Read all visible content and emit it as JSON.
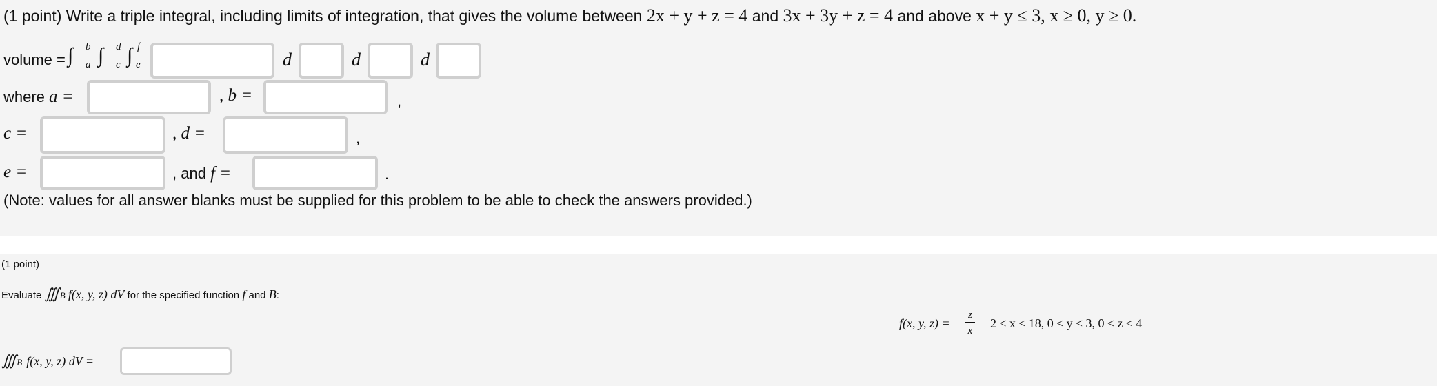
{
  "problem1": {
    "prefix": "(1 point) Write a triple integral, including limits of integration, that gives the volume between",
    "plane1": "2x + y + z = 4",
    "and1": "and",
    "plane2": "3x + 3y + z = 4",
    "and_above": "and above",
    "region": "x + y ≤ 3, x ≥ 0, y ≥ 0.",
    "volume_label": "volume =",
    "integral": "∫",
    "upper1": "b",
    "lower1": "a",
    "upper2": "d",
    "lower2": "c",
    "upper3": "f",
    "lower3": "e",
    "d_label": "d",
    "where": "where",
    "a_eq": "a =",
    "b_eq": ", b =",
    "c_eq": "c =",
    "d_eq": ", d =",
    "e_eq": "e =",
    "and_f": ", and",
    "f_eq": "f =",
    "comma": ",",
    "period": ".",
    "note": "(Note: values for all answer blanks must be supplied for this problem to be able to check the answers provided.)"
  },
  "problem2": {
    "points": "(1 point)",
    "evaluate": "Evaluate",
    "triple_int": "∭",
    "sub_B": "B",
    "integrand": "f(x, y, z) dV",
    "for_text": "for the specified function",
    "f_var": "f",
    "and_text": "and",
    "B_var": "B",
    "colon": ":",
    "f_def": "f(x, y, z) =",
    "frac_num": "z",
    "frac_den": "x",
    "bounds": "2 ≤ x ≤ 18, 0 ≤ y ≤ 3, 0 ≤ z ≤ 4",
    "answer_label": "f(x, y, z) dV ="
  }
}
